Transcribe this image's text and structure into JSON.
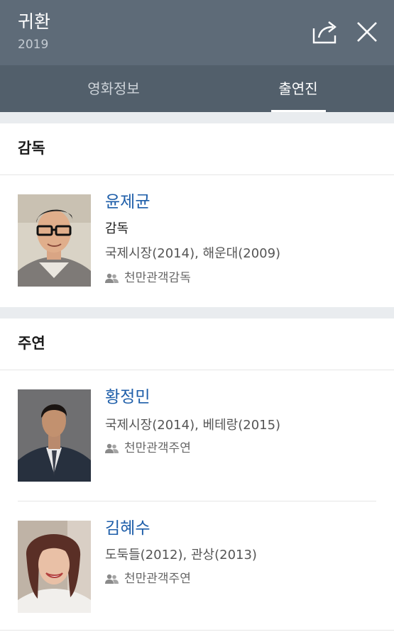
{
  "header": {
    "title": "귀환",
    "year": "2019",
    "share_icon": "share-icon",
    "close_icon": "close-icon"
  },
  "tabs": [
    {
      "label": "영화정보",
      "active": false
    },
    {
      "label": "출연진",
      "active": true
    }
  ],
  "sections": {
    "director": {
      "title": "감독",
      "people": [
        {
          "name": "윤제균",
          "role": "감독",
          "works": "국제시장(2014), 해운대(2009)",
          "badge": "천만관객감독"
        }
      ]
    },
    "lead": {
      "title": "주연",
      "people": [
        {
          "name": "황정민",
          "works": "국제시장(2014), 베테랑(2015)",
          "badge": "천만관객주연"
        },
        {
          "name": "김혜수",
          "works": "도둑들(2012), 관상(2013)",
          "badge": "천만관객주연"
        }
      ]
    }
  },
  "colors": {
    "header_bg": "#5e6b78",
    "tab_bg": "#525f6b",
    "name_link": "#1e5ea9",
    "spacer": "#e9ecef"
  }
}
